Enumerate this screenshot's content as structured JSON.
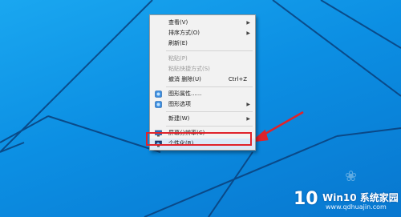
{
  "menu": {
    "items": [
      {
        "label": "查看(V)",
        "shortcut": "",
        "submenu": true,
        "disabled": false
      },
      {
        "label": "排序方式(O)",
        "shortcut": "",
        "submenu": true,
        "disabled": false
      },
      {
        "label": "刷新(E)",
        "shortcut": "",
        "submenu": false,
        "disabled": false
      },
      {
        "label": "粘贴(P)",
        "shortcut": "",
        "submenu": false,
        "disabled": true
      },
      {
        "label": "粘贴快捷方式(S)",
        "shortcut": "",
        "submenu": false,
        "disabled": true
      },
      {
        "label": "撤消 删除(U)",
        "shortcut": "Ctrl+Z",
        "submenu": false,
        "disabled": false
      },
      {
        "label": "图形属性......",
        "shortcut": "",
        "submenu": false,
        "disabled": false,
        "icon": "graphics-properties-icon"
      },
      {
        "label": "图形选项",
        "shortcut": "",
        "submenu": true,
        "disabled": false,
        "icon": "graphics-options-icon"
      },
      {
        "label": "新建(W)",
        "shortcut": "",
        "submenu": true,
        "disabled": false
      },
      {
        "label": "屏幕分辨率(C)",
        "shortcut": "",
        "submenu": false,
        "disabled": false,
        "icon": "screen-resolution-icon"
      },
      {
        "label": "个性化(R)",
        "shortcut": "",
        "submenu": false,
        "disabled": false,
        "icon": "personalize-icon",
        "highlighted": true
      }
    ]
  },
  "watermark": {
    "number": "10",
    "brand": "Win10 系统家园",
    "url": "www.qdhuajin.com"
  },
  "colors": {
    "highlight_box": "#e0232b",
    "menu_bg": "#f2f2f2",
    "desktop": "#0c8fe3"
  }
}
